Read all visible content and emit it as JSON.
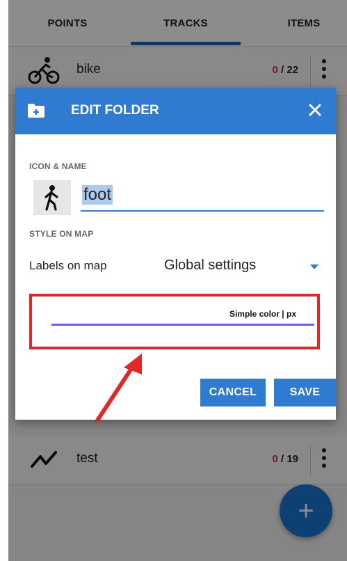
{
  "tabs": [
    {
      "label": "POINTS"
    },
    {
      "label": "TRACKS"
    },
    {
      "label": "ITEMS"
    }
  ],
  "list": {
    "rows": [
      {
        "icon": "bike-icon",
        "name": "bike",
        "count_zero": "0",
        "count_total": " / 22"
      },
      {
        "icon": "track-line-icon",
        "name": "test",
        "count_zero": "0",
        "count_total": " / 19"
      }
    ]
  },
  "fab": {
    "label": "+"
  },
  "dialog": {
    "title": "EDIT FOLDER",
    "section_icon_name": "ICON & NAME",
    "folder_icon": "hiking-person-icon",
    "name_value": "foot",
    "section_style": "STYLE ON MAP",
    "labels_on_map_label": "Labels on map",
    "labels_on_map_value": "Global settings",
    "style_caption": "Simple color | px",
    "style_line_color": "#6a5cff",
    "cancel_label": "CANCEL",
    "save_label": "SAVE"
  },
  "colors": {
    "accent": "#2e7bd1",
    "highlight_box": "#e32626",
    "count_zero": "#d32f2f"
  }
}
